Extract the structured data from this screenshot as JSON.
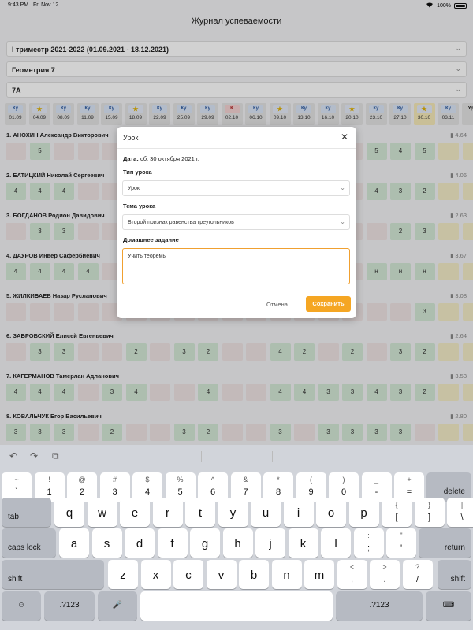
{
  "status": {
    "time": "9:43 PM",
    "date": "Fri Nov 12",
    "battery": "100%"
  },
  "app_title": "Журнал успеваемости",
  "filters": {
    "term": "I триместр 2021-2022 (01.09.2021 - 18.12.2021)",
    "subject": "Геометрия 7",
    "class": "7А"
  },
  "dates": [
    {
      "d": "01.09",
      "b": "Ку",
      "t": "ku"
    },
    {
      "d": "04.09",
      "b": "★",
      "t": "star"
    },
    {
      "d": "08.09",
      "b": "Ку",
      "t": "ku"
    },
    {
      "d": "11.09",
      "b": "Ку",
      "t": "ku"
    },
    {
      "d": "15.09",
      "b": "Ку",
      "t": "ku"
    },
    {
      "d": "18.09",
      "b": "★",
      "t": "star"
    },
    {
      "d": "22.09",
      "b": "Ку",
      "t": "ku"
    },
    {
      "d": "25.09",
      "b": "Ку",
      "t": "ku"
    },
    {
      "d": "29.09",
      "b": "Ку",
      "t": "ku"
    },
    {
      "d": "02.10",
      "b": "К",
      "t": "k"
    },
    {
      "d": "06.10",
      "b": "Ку",
      "t": "ku"
    },
    {
      "d": "09.10",
      "b": "★",
      "t": "star"
    },
    {
      "d": "13.10",
      "b": "Ку",
      "t": "ku"
    },
    {
      "d": "16.10",
      "b": "Ку",
      "t": "ku"
    },
    {
      "d": "20.10",
      "b": "★",
      "t": "star"
    },
    {
      "d": "23.10",
      "b": "Ку",
      "t": "ku"
    },
    {
      "d": "27.10",
      "b": "Ку",
      "t": "ku"
    },
    {
      "d": "30.10",
      "b": "★",
      "t": "star",
      "hl": true
    },
    {
      "d": "03.11",
      "b": "Ку",
      "t": "ku"
    },
    {
      "d": "",
      "b": "Уро",
      "t": "none"
    }
  ],
  "students": [
    {
      "name": "1. АНОХИН Александр Викторович",
      "avg": "4.64",
      "marks": [
        [
          "e",
          ""
        ],
        [
          "g",
          "5"
        ],
        [
          "e",
          ""
        ],
        [
          "e",
          ""
        ],
        [
          "e",
          ""
        ],
        [
          "e",
          ""
        ],
        [
          "e",
          ""
        ],
        [
          "e",
          ""
        ],
        [
          "e",
          ""
        ],
        [
          "e",
          ""
        ],
        [
          "e",
          ""
        ],
        [
          "e",
          ""
        ],
        [
          "e",
          ""
        ],
        [
          "e",
          ""
        ],
        [
          "e",
          ""
        ],
        [
          "g",
          "5"
        ],
        [
          "g",
          "4"
        ],
        [
          "g",
          "5"
        ],
        [
          "y",
          ""
        ],
        [
          "y",
          ""
        ]
      ]
    },
    {
      "name": "2. БАТИЦКИЙ Николай Сергеевич",
      "avg": "4.06",
      "marks": [
        [
          "g",
          "4"
        ],
        [
          "g",
          "4"
        ],
        [
          "g",
          "4"
        ],
        [
          "e",
          ""
        ],
        [
          "e",
          ""
        ],
        [
          "e",
          ""
        ],
        [
          "e",
          ""
        ],
        [
          "e",
          ""
        ],
        [
          "e",
          ""
        ],
        [
          "e",
          ""
        ],
        [
          "e",
          ""
        ],
        [
          "e",
          ""
        ],
        [
          "e",
          ""
        ],
        [
          "e",
          ""
        ],
        [
          "e",
          ""
        ],
        [
          "g",
          "4"
        ],
        [
          "g",
          "3"
        ],
        [
          "g",
          "2"
        ],
        [
          "y",
          ""
        ],
        [
          "y",
          ""
        ]
      ]
    },
    {
      "name": "3. БОГДАНОВ Родион Давидович",
      "avg": "2.63",
      "marks": [
        [
          "e",
          ""
        ],
        [
          "g",
          "3"
        ],
        [
          "g",
          "3"
        ],
        [
          "e",
          ""
        ],
        [
          "e",
          ""
        ],
        [
          "e",
          ""
        ],
        [
          "e",
          ""
        ],
        [
          "e",
          ""
        ],
        [
          "e",
          ""
        ],
        [
          "e",
          ""
        ],
        [
          "e",
          ""
        ],
        [
          "e",
          ""
        ],
        [
          "e",
          ""
        ],
        [
          "e",
          ""
        ],
        [
          "e",
          ""
        ],
        [
          "e",
          ""
        ],
        [
          "g",
          "2"
        ],
        [
          "g",
          "3"
        ],
        [
          "y",
          ""
        ],
        [
          "y",
          ""
        ]
      ]
    },
    {
      "name": "4. ДАУРОВ Инвер Сафербиевич",
      "avg": "3.67",
      "marks": [
        [
          "g",
          "4"
        ],
        [
          "g",
          "4"
        ],
        [
          "g",
          "4"
        ],
        [
          "g",
          "4"
        ],
        [
          "e",
          ""
        ],
        [
          "e",
          ""
        ],
        [
          "e",
          ""
        ],
        [
          "e",
          ""
        ],
        [
          "e",
          ""
        ],
        [
          "e",
          ""
        ],
        [
          "e",
          ""
        ],
        [
          "e",
          ""
        ],
        [
          "e",
          ""
        ],
        [
          "e",
          ""
        ],
        [
          "e",
          ""
        ],
        [
          "g",
          "н"
        ],
        [
          "g",
          "н"
        ],
        [
          "g",
          "н"
        ],
        [
          "y",
          ""
        ],
        [
          "y",
          ""
        ]
      ]
    },
    {
      "name": "5. ЖИЛКИБАЕВ Назар Русланович",
      "avg": "3.08",
      "marks": [
        [
          "e",
          ""
        ],
        [
          "e",
          ""
        ],
        [
          "e",
          ""
        ],
        [
          "e",
          ""
        ],
        [
          "e",
          ""
        ],
        [
          "e",
          ""
        ],
        [
          "e",
          ""
        ],
        [
          "e",
          ""
        ],
        [
          "e",
          ""
        ],
        [
          "e",
          ""
        ],
        [
          "e",
          ""
        ],
        [
          "e",
          ""
        ],
        [
          "e",
          ""
        ],
        [
          "e",
          ""
        ],
        [
          "e",
          ""
        ],
        [
          "e",
          ""
        ],
        [
          "e",
          ""
        ],
        [
          "g",
          "3"
        ],
        [
          "y",
          ""
        ],
        [
          "y",
          ""
        ]
      ]
    },
    {
      "name": "6. ЗАБРОВСКИЙ Елисей Евгеньевич",
      "avg": "2.64",
      "marks": [
        [
          "e",
          ""
        ],
        [
          "g",
          "3"
        ],
        [
          "g",
          "3"
        ],
        [
          "e",
          ""
        ],
        [
          "e",
          ""
        ],
        [
          "g",
          "2"
        ],
        [
          "e",
          ""
        ],
        [
          "g",
          "3"
        ],
        [
          "g",
          "2"
        ],
        [
          "e",
          ""
        ],
        [
          "e",
          ""
        ],
        [
          "g",
          "4"
        ],
        [
          "g",
          "2"
        ],
        [
          "e",
          ""
        ],
        [
          "g",
          "2"
        ],
        [
          "e",
          ""
        ],
        [
          "g",
          "3"
        ],
        [
          "g",
          "2"
        ],
        [
          "y",
          ""
        ],
        [
          "y",
          ""
        ]
      ]
    },
    {
      "name": "7. КАГЕРМАНОВ Тамерлан Адланович",
      "avg": "3.53",
      "marks": [
        [
          "g",
          "4"
        ],
        [
          "g",
          "4"
        ],
        [
          "g",
          "4"
        ],
        [
          "e",
          ""
        ],
        [
          "g",
          "3"
        ],
        [
          "g",
          "4"
        ],
        [
          "e",
          ""
        ],
        [
          "e",
          ""
        ],
        [
          "g",
          "4"
        ],
        [
          "e",
          ""
        ],
        [
          "e",
          ""
        ],
        [
          "g",
          "4"
        ],
        [
          "g",
          "4"
        ],
        [
          "g",
          "3"
        ],
        [
          "g",
          "3"
        ],
        [
          "g",
          "4"
        ],
        [
          "g",
          "3"
        ],
        [
          "g",
          "2"
        ],
        [
          "y",
          ""
        ],
        [
          "y",
          ""
        ]
      ]
    },
    {
      "name": "8. КОВАЛЬЧУК Егор Васильевич",
      "avg": "2.80",
      "marks": [
        [
          "g",
          "3"
        ],
        [
          "g",
          "3"
        ],
        [
          "g",
          "3"
        ],
        [
          "e",
          ""
        ],
        [
          "g",
          "2"
        ],
        [
          "e",
          ""
        ],
        [
          "e",
          ""
        ],
        [
          "g",
          "3"
        ],
        [
          "g",
          "2"
        ],
        [
          "e",
          ""
        ],
        [
          "e",
          ""
        ],
        [
          "g",
          "3"
        ],
        [
          "e",
          ""
        ],
        [
          "g",
          "3"
        ],
        [
          "g",
          "3"
        ],
        [
          "g",
          "3"
        ],
        [
          "g",
          "3"
        ],
        [
          "e",
          ""
        ],
        [
          "y",
          ""
        ],
        [
          "y",
          ""
        ]
      ]
    }
  ],
  "modal": {
    "title": "Урок",
    "date_label": "Дата:",
    "date_value": "сб, 30 октября 2021 г.",
    "type_label": "Тип урока",
    "type_value": "Урок",
    "topic_label": "Тема урока",
    "topic_value": "Второй признак равенства треугольников",
    "homework_label": "Домашнее задание",
    "homework_value": "Учить теоремы",
    "cancel": "Отмена",
    "save": "Сохранить"
  },
  "keyboard": {
    "row1": [
      [
        "~",
        "`"
      ],
      [
        "!",
        "1"
      ],
      [
        "@",
        "2"
      ],
      [
        "#",
        "3"
      ],
      [
        "$",
        "4"
      ],
      [
        "%",
        "5"
      ],
      [
        "^",
        "6"
      ],
      [
        "&",
        "7"
      ],
      [
        "*",
        "8"
      ],
      [
        "(",
        "9"
      ],
      [
        ")",
        "0"
      ],
      [
        "_",
        "-"
      ],
      [
        "+",
        "="
      ]
    ],
    "row2": [
      "q",
      "w",
      "e",
      "r",
      "t",
      "y",
      "u",
      "i",
      "o",
      "p",
      [
        "{",
        "["
      ],
      [
        "}",
        "]"
      ],
      [
        "|",
        "\\"
      ]
    ],
    "row3": [
      "a",
      "s",
      "d",
      "f",
      "g",
      "h",
      "j",
      "k",
      "l",
      [
        ":",
        ";"
      ],
      [
        "\"",
        "'"
      ]
    ],
    "row4": [
      "z",
      "x",
      "c",
      "v",
      "b",
      "n",
      "m",
      [
        "<",
        ","
      ],
      [
        ">",
        "."
      ],
      [
        "?",
        "/"
      ]
    ],
    "delete": "delete",
    "tab": "tab",
    "caps": "caps lock",
    "return": "return",
    "shift": "shift",
    "num": ".?123"
  }
}
